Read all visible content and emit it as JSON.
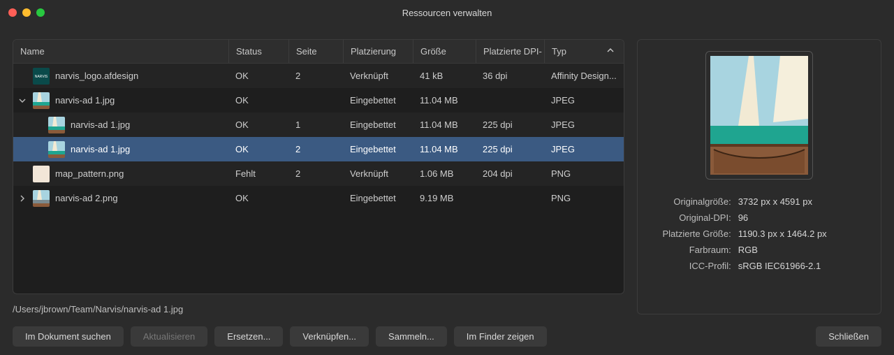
{
  "window": {
    "title": "Ressourcen verwalten"
  },
  "columns": {
    "name": "Name",
    "status": "Status",
    "seite": "Seite",
    "platzierung": "Platzierung",
    "groesse": "Größe",
    "dpi": "Platzierte DPI-",
    "typ": "Typ"
  },
  "rows": [
    {
      "indent": 0,
      "disclosure": "",
      "thumb": "narvis",
      "name": "narvis_logo.afdesign",
      "status": "OK",
      "seite": "2",
      "platz": "Verknüpft",
      "groesse": "41 kB",
      "dpi": "36 dpi",
      "typ": "Affinity Design...",
      "selected": false
    },
    {
      "indent": 0,
      "disclosure": "down",
      "thumb": "boat",
      "name": "narvis-ad 1.jpg",
      "status": "OK",
      "seite": "",
      "platz": "Eingebettet",
      "groesse": "11.04 MB",
      "dpi": "",
      "typ": "JPEG",
      "selected": false
    },
    {
      "indent": 1,
      "disclosure": "",
      "thumb": "boat-sm",
      "name": "narvis-ad 1.jpg",
      "status": "OK",
      "seite": "1",
      "platz": "Eingebettet",
      "groesse": "11.04 MB",
      "dpi": "225 dpi",
      "typ": "JPEG",
      "selected": false
    },
    {
      "indent": 1,
      "disclosure": "",
      "thumb": "boat-sm",
      "name": "narvis-ad 1.jpg",
      "status": "OK",
      "seite": "2",
      "platz": "Eingebettet",
      "groesse": "11.04 MB",
      "dpi": "225 dpi",
      "typ": "JPEG",
      "selected": true
    },
    {
      "indent": 0,
      "disclosure": "",
      "thumb": "blank",
      "name": "map_pattern.png",
      "status": "Fehlt",
      "seite": "2",
      "platz": "Verknüpft",
      "groesse": "1.06 MB",
      "dpi": "204 dpi",
      "typ": "PNG",
      "selected": false
    },
    {
      "indent": 0,
      "disclosure": "right",
      "thumb": "boat2",
      "name": "narvis-ad 2.png",
      "status": "OK",
      "seite": "",
      "platz": "Eingebettet",
      "groesse": "9.19 MB",
      "dpi": "",
      "typ": "PNG",
      "selected": false
    }
  ],
  "filepath": "/Users/jbrown/Team/Narvis/narvis-ad 1.jpg",
  "meta": {
    "labels": {
      "original_size": "Originalgröße:",
      "original_dpi": "Original-DPI:",
      "placed_size": "Platzierte Größe:",
      "colorspace": "Farbraum:",
      "icc": "ICC-Profil:"
    },
    "values": {
      "original_size": "3732 px x 4591 px",
      "original_dpi": "96",
      "placed_size": "1190.3 px x 1464.2 px",
      "colorspace": "RGB",
      "icc": "sRGB IEC61966-2.1"
    }
  },
  "buttons": {
    "search": "Im Dokument suchen",
    "update": "Aktualisieren",
    "replace": "Ersetzen...",
    "link": "Verknüpfen...",
    "collect": "Sammeln...",
    "finder": "Im Finder zeigen",
    "close": "Schließen"
  }
}
